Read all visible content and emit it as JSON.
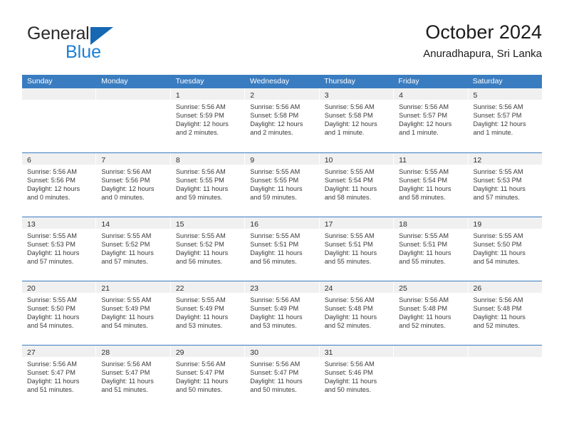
{
  "brand": {
    "name_top": "General",
    "name_bottom": "Blue",
    "triangle_color": "#1668b3",
    "blue_text_color": "#1b7fd4"
  },
  "header": {
    "title": "October 2024",
    "subtitle": "Anuradhapura, Sri Lanka"
  },
  "theme": {
    "header_blue": "#3a7cc0",
    "date_band_gray": "#f0f0f0",
    "body_text": "#3a3a3a"
  },
  "weekdays": [
    "Sunday",
    "Monday",
    "Tuesday",
    "Wednesday",
    "Thursday",
    "Friday",
    "Saturday"
  ],
  "labels": {
    "sunrise_prefix": "Sunrise:",
    "sunset_prefix": "Sunset:",
    "daylight_prefix": "Daylight:"
  },
  "weeks": [
    [
      {
        "date": "",
        "lines": []
      },
      {
        "date": "",
        "lines": []
      },
      {
        "date": "1",
        "lines": [
          "Sunrise: 5:56 AM",
          "Sunset: 5:59 PM",
          "Daylight: 12 hours and 2 minutes."
        ]
      },
      {
        "date": "2",
        "lines": [
          "Sunrise: 5:56 AM",
          "Sunset: 5:58 PM",
          "Daylight: 12 hours and 2 minutes."
        ]
      },
      {
        "date": "3",
        "lines": [
          "Sunrise: 5:56 AM",
          "Sunset: 5:58 PM",
          "Daylight: 12 hours and 1 minute."
        ]
      },
      {
        "date": "4",
        "lines": [
          "Sunrise: 5:56 AM",
          "Sunset: 5:57 PM",
          "Daylight: 12 hours and 1 minute."
        ]
      },
      {
        "date": "5",
        "lines": [
          "Sunrise: 5:56 AM",
          "Sunset: 5:57 PM",
          "Daylight: 12 hours and 1 minute."
        ]
      }
    ],
    [
      {
        "date": "6",
        "lines": [
          "Sunrise: 5:56 AM",
          "Sunset: 5:56 PM",
          "Daylight: 12 hours and 0 minutes."
        ]
      },
      {
        "date": "7",
        "lines": [
          "Sunrise: 5:56 AM",
          "Sunset: 5:56 PM",
          "Daylight: 12 hours and 0 minutes."
        ]
      },
      {
        "date": "8",
        "lines": [
          "Sunrise: 5:56 AM",
          "Sunset: 5:55 PM",
          "Daylight: 11 hours and 59 minutes."
        ]
      },
      {
        "date": "9",
        "lines": [
          "Sunrise: 5:55 AM",
          "Sunset: 5:55 PM",
          "Daylight: 11 hours and 59 minutes."
        ]
      },
      {
        "date": "10",
        "lines": [
          "Sunrise: 5:55 AM",
          "Sunset: 5:54 PM",
          "Daylight: 11 hours and 58 minutes."
        ]
      },
      {
        "date": "11",
        "lines": [
          "Sunrise: 5:55 AM",
          "Sunset: 5:54 PM",
          "Daylight: 11 hours and 58 minutes."
        ]
      },
      {
        "date": "12",
        "lines": [
          "Sunrise: 5:55 AM",
          "Sunset: 5:53 PM",
          "Daylight: 11 hours and 57 minutes."
        ]
      }
    ],
    [
      {
        "date": "13",
        "lines": [
          "Sunrise: 5:55 AM",
          "Sunset: 5:53 PM",
          "Daylight: 11 hours and 57 minutes."
        ]
      },
      {
        "date": "14",
        "lines": [
          "Sunrise: 5:55 AM",
          "Sunset: 5:52 PM",
          "Daylight: 11 hours and 57 minutes."
        ]
      },
      {
        "date": "15",
        "lines": [
          "Sunrise: 5:55 AM",
          "Sunset: 5:52 PM",
          "Daylight: 11 hours and 56 minutes."
        ]
      },
      {
        "date": "16",
        "lines": [
          "Sunrise: 5:55 AM",
          "Sunset: 5:51 PM",
          "Daylight: 11 hours and 56 minutes."
        ]
      },
      {
        "date": "17",
        "lines": [
          "Sunrise: 5:55 AM",
          "Sunset: 5:51 PM",
          "Daylight: 11 hours and 55 minutes."
        ]
      },
      {
        "date": "18",
        "lines": [
          "Sunrise: 5:55 AM",
          "Sunset: 5:51 PM",
          "Daylight: 11 hours and 55 minutes."
        ]
      },
      {
        "date": "19",
        "lines": [
          "Sunrise: 5:55 AM",
          "Sunset: 5:50 PM",
          "Daylight: 11 hours and 54 minutes."
        ]
      }
    ],
    [
      {
        "date": "20",
        "lines": [
          "Sunrise: 5:55 AM",
          "Sunset: 5:50 PM",
          "Daylight: 11 hours and 54 minutes."
        ]
      },
      {
        "date": "21",
        "lines": [
          "Sunrise: 5:55 AM",
          "Sunset: 5:49 PM",
          "Daylight: 11 hours and 54 minutes."
        ]
      },
      {
        "date": "22",
        "lines": [
          "Sunrise: 5:55 AM",
          "Sunset: 5:49 PM",
          "Daylight: 11 hours and 53 minutes."
        ]
      },
      {
        "date": "23",
        "lines": [
          "Sunrise: 5:56 AM",
          "Sunset: 5:49 PM",
          "Daylight: 11 hours and 53 minutes."
        ]
      },
      {
        "date": "24",
        "lines": [
          "Sunrise: 5:56 AM",
          "Sunset: 5:48 PM",
          "Daylight: 11 hours and 52 minutes."
        ]
      },
      {
        "date": "25",
        "lines": [
          "Sunrise: 5:56 AM",
          "Sunset: 5:48 PM",
          "Daylight: 11 hours and 52 minutes."
        ]
      },
      {
        "date": "26",
        "lines": [
          "Sunrise: 5:56 AM",
          "Sunset: 5:48 PM",
          "Daylight: 11 hours and 52 minutes."
        ]
      }
    ],
    [
      {
        "date": "27",
        "lines": [
          "Sunrise: 5:56 AM",
          "Sunset: 5:47 PM",
          "Daylight: 11 hours and 51 minutes."
        ]
      },
      {
        "date": "28",
        "lines": [
          "Sunrise: 5:56 AM",
          "Sunset: 5:47 PM",
          "Daylight: 11 hours and 51 minutes."
        ]
      },
      {
        "date": "29",
        "lines": [
          "Sunrise: 5:56 AM",
          "Sunset: 5:47 PM",
          "Daylight: 11 hours and 50 minutes."
        ]
      },
      {
        "date": "30",
        "lines": [
          "Sunrise: 5:56 AM",
          "Sunset: 5:47 PM",
          "Daylight: 11 hours and 50 minutes."
        ]
      },
      {
        "date": "31",
        "lines": [
          "Sunrise: 5:56 AM",
          "Sunset: 5:46 PM",
          "Daylight: 11 hours and 50 minutes."
        ]
      },
      {
        "date": "",
        "lines": []
      },
      {
        "date": "",
        "lines": []
      }
    ]
  ]
}
